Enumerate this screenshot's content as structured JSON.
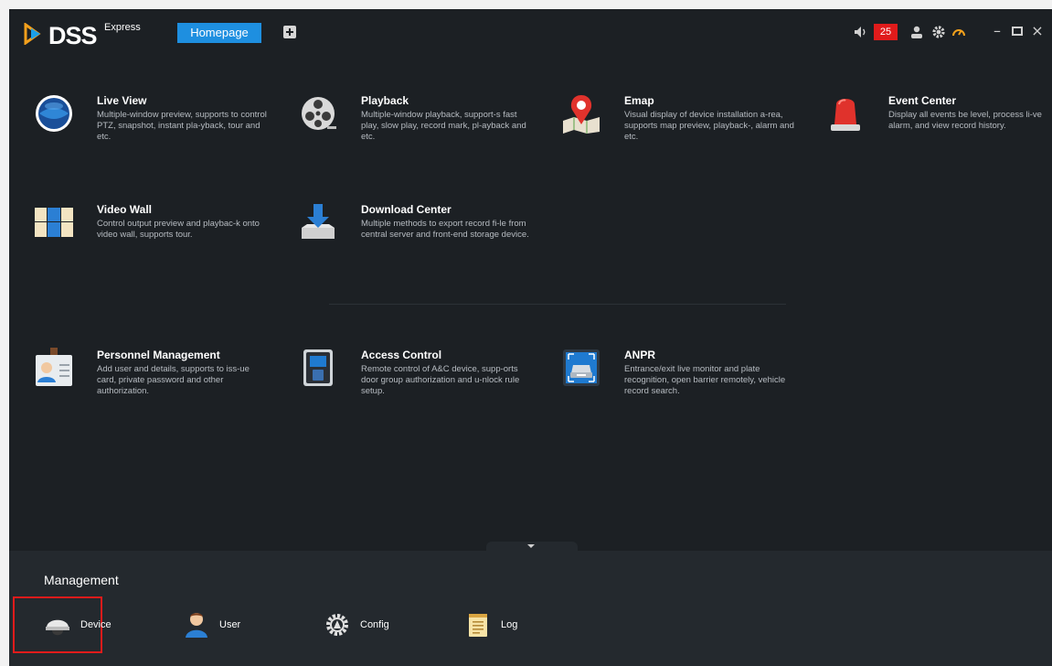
{
  "titlebar": {
    "logo_text": "DSS",
    "logo_sup": "Express",
    "tab_home": "Homepage",
    "alarm_count": "25",
    "colors": {
      "accent": "#1e8fe0",
      "alarm": "#e01b1b",
      "background": "#1c2024"
    }
  },
  "modules": [
    {
      "title": "Live View",
      "desc": "Multiple-window preview, supports to control PTZ, snapshot, instant pla-yback, tour and etc.",
      "icon": "live-view-icon"
    },
    {
      "title": "Playback",
      "desc": "Multiple-window playback, support-s fast play, slow play, record mark, pl-ayback and etc.",
      "icon": "film-reel-icon"
    },
    {
      "title": "Emap",
      "desc": "Visual display of device installation a-rea, supports map preview, playback-, alarm and etc.",
      "icon": "map-pin-icon"
    },
    {
      "title": "Event Center",
      "desc": "Display all events be level, process li-ve alarm, and view record history.",
      "icon": "alarm-light-icon"
    },
    {
      "title": "Video Wall",
      "desc": "Control output preview and playbac-k onto video wall, supports tour.",
      "icon": "video-wall-icon"
    },
    {
      "title": "Download Center",
      "desc": "Multiple methods to export record fi-le from central server and front-end storage device.",
      "icon": "download-icon"
    },
    {
      "title": "Personnel Management",
      "desc": "Add user and details, supports to iss-ue card, private password and other authorization.",
      "icon": "id-card-icon"
    },
    {
      "title": "Access Control",
      "desc": "Remote control of A&C device, supp-orts door group authorization and u-nlock rule setup.",
      "icon": "keypad-icon"
    },
    {
      "title": "ANPR",
      "desc": "Entrance/exit live monitor and plate recognition, open barrier remotely, vehicle record search.",
      "icon": "car-camera-icon"
    }
  ],
  "management": {
    "title": "Management",
    "items": [
      {
        "label": "Device",
        "icon": "dome-camera-icon"
      },
      {
        "label": "User",
        "icon": "user-icon"
      },
      {
        "label": "Config",
        "icon": "gear-icon"
      },
      {
        "label": "Log",
        "icon": "notepad-icon"
      }
    ]
  }
}
